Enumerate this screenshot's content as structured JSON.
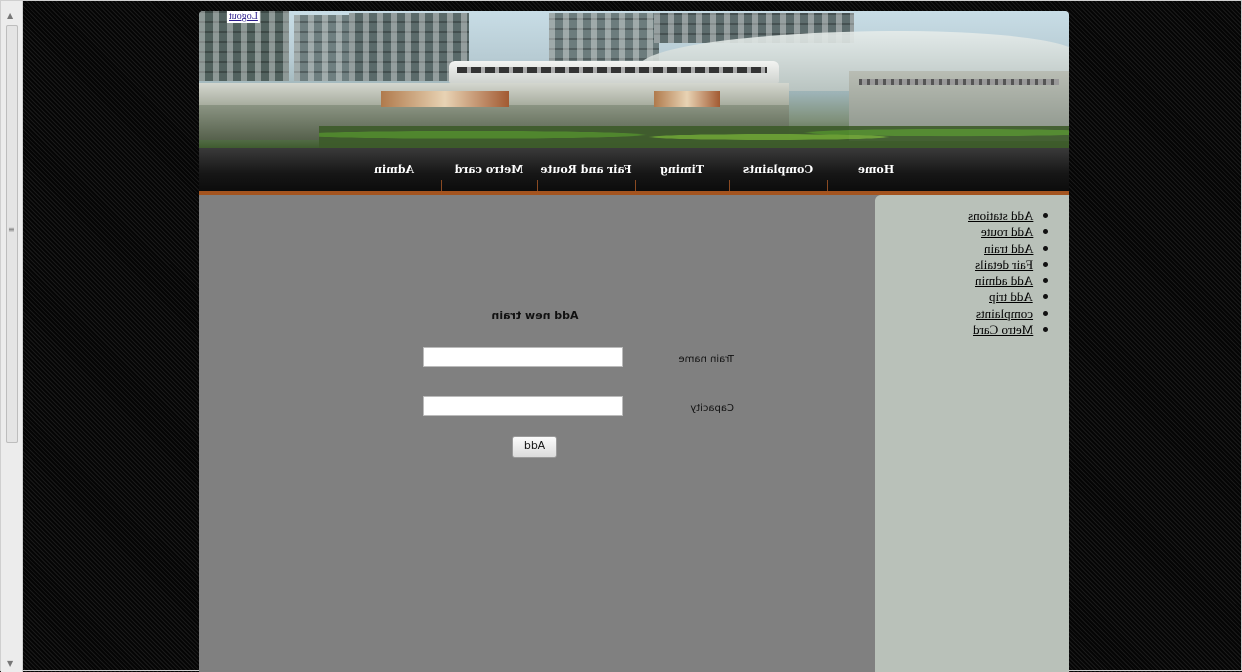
{
  "header": {
    "logout_label": "Logout"
  },
  "nav": {
    "items": [
      "Home",
      "Complaints",
      "Timing",
      "Fair and Route",
      "Metro card",
      "Admin"
    ]
  },
  "form": {
    "title": "Add new train",
    "train_name_label": "Train name",
    "train_name_value": "",
    "capacity_label": "Capacity",
    "capacity_value": "",
    "add_button_label": "Add"
  },
  "sidebar": {
    "links": [
      "Add stations",
      "Add route",
      "Add train",
      "Fair details",
      "Add admin",
      "Add trip",
      "complaints",
      "Metro Card"
    ]
  },
  "theme": {
    "nav_accent": "#a4541f",
    "content_bg": "#808080",
    "sidebar_bg": "#b9c1b9"
  }
}
